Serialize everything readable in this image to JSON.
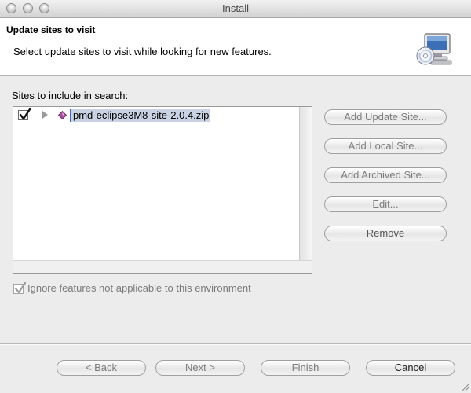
{
  "window": {
    "title": "Install"
  },
  "header": {
    "title": "Update sites to visit",
    "description": "Select update sites to visit while looking for new features.",
    "icon": "install-wizard-icon"
  },
  "sites": {
    "label": "Sites to include in search:",
    "items": [
      {
        "label": "pmd-eclipse3M8-site-2.0.4.zip",
        "checked": true,
        "icon": "archive-site-icon"
      }
    ]
  },
  "side_buttons": {
    "add_update_site": "Add Update Site...",
    "add_local_site": "Add Local Site...",
    "add_archived_site": "Add Archived Site...",
    "edit": "Edit...",
    "remove": "Remove"
  },
  "options": {
    "ignore_label": "Ignore features not applicable to this environment",
    "ignore_checked": true
  },
  "nav_buttons": {
    "back": "< Back",
    "next": "Next >",
    "finish": "Finish",
    "cancel": "Cancel"
  },
  "colors": {
    "selection": "#c9d3e4",
    "window_bg": "#ececec"
  }
}
